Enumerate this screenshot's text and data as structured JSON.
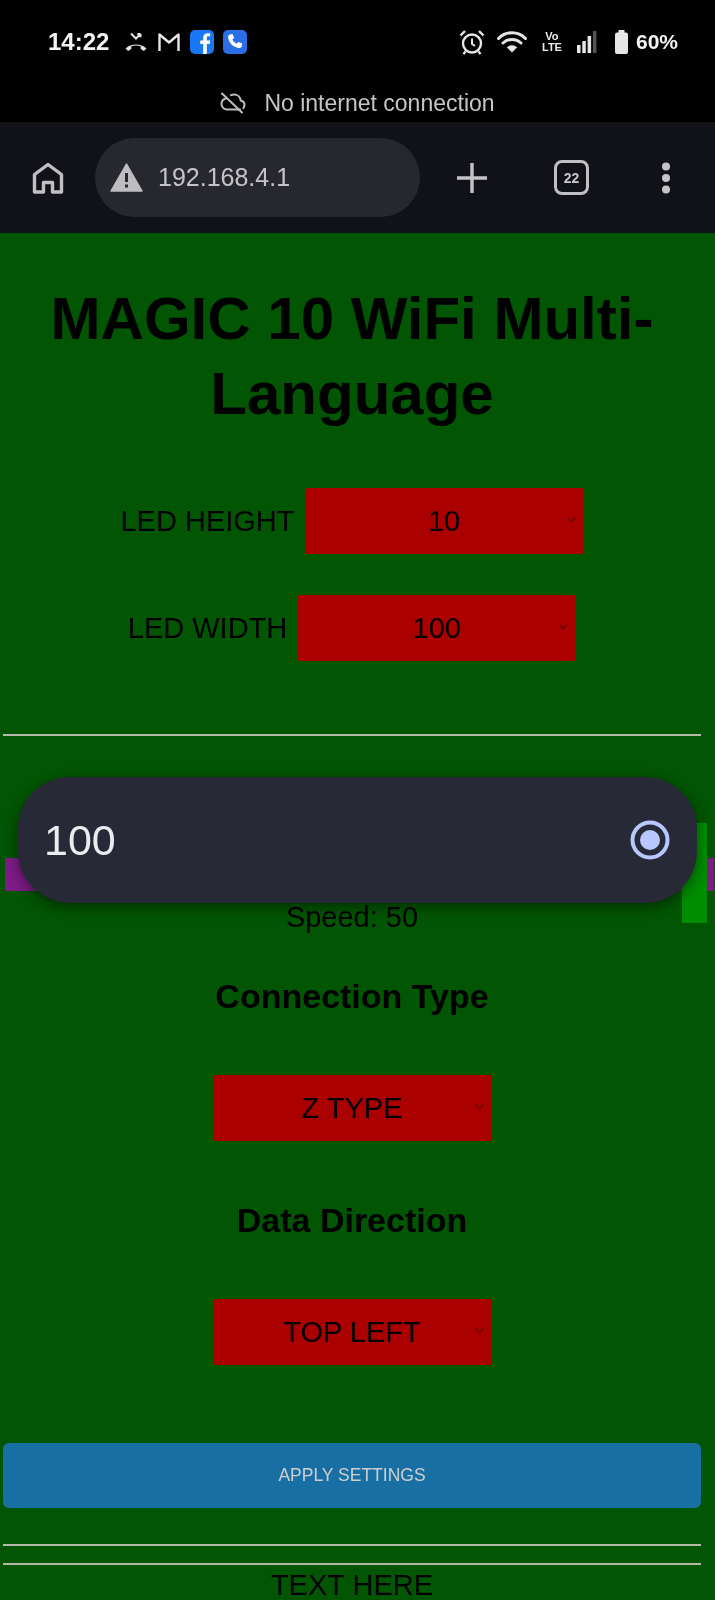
{
  "status_bar": {
    "time": "14:22",
    "network_type": "Vo LTE",
    "battery": "60%"
  },
  "connection_notice": "No internet connection",
  "browser_toolbar": {
    "url": "192.168.4.1",
    "tab_count": "22"
  },
  "page": {
    "title": "MAGIC 10 WiFi Multi-Language",
    "dimension_fields": [
      {
        "label": "LED HEIGHT",
        "value": "10"
      },
      {
        "label": "LED WIDTH",
        "value": "100"
      }
    ],
    "speed_slider": {
      "level": 0.99
    },
    "speed_reading": "Speed: 50",
    "sections": [
      {
        "heading": "Connection Type",
        "value": "Z TYPE"
      },
      {
        "heading": "Data Direction",
        "value": "TOP LEFT"
      }
    ],
    "apply_button": "APPLY SETTINGS",
    "text_heading": "TEXT HERE"
  },
  "select_popup": {
    "options": [
      {
        "label": "100",
        "selected": true
      }
    ]
  }
}
